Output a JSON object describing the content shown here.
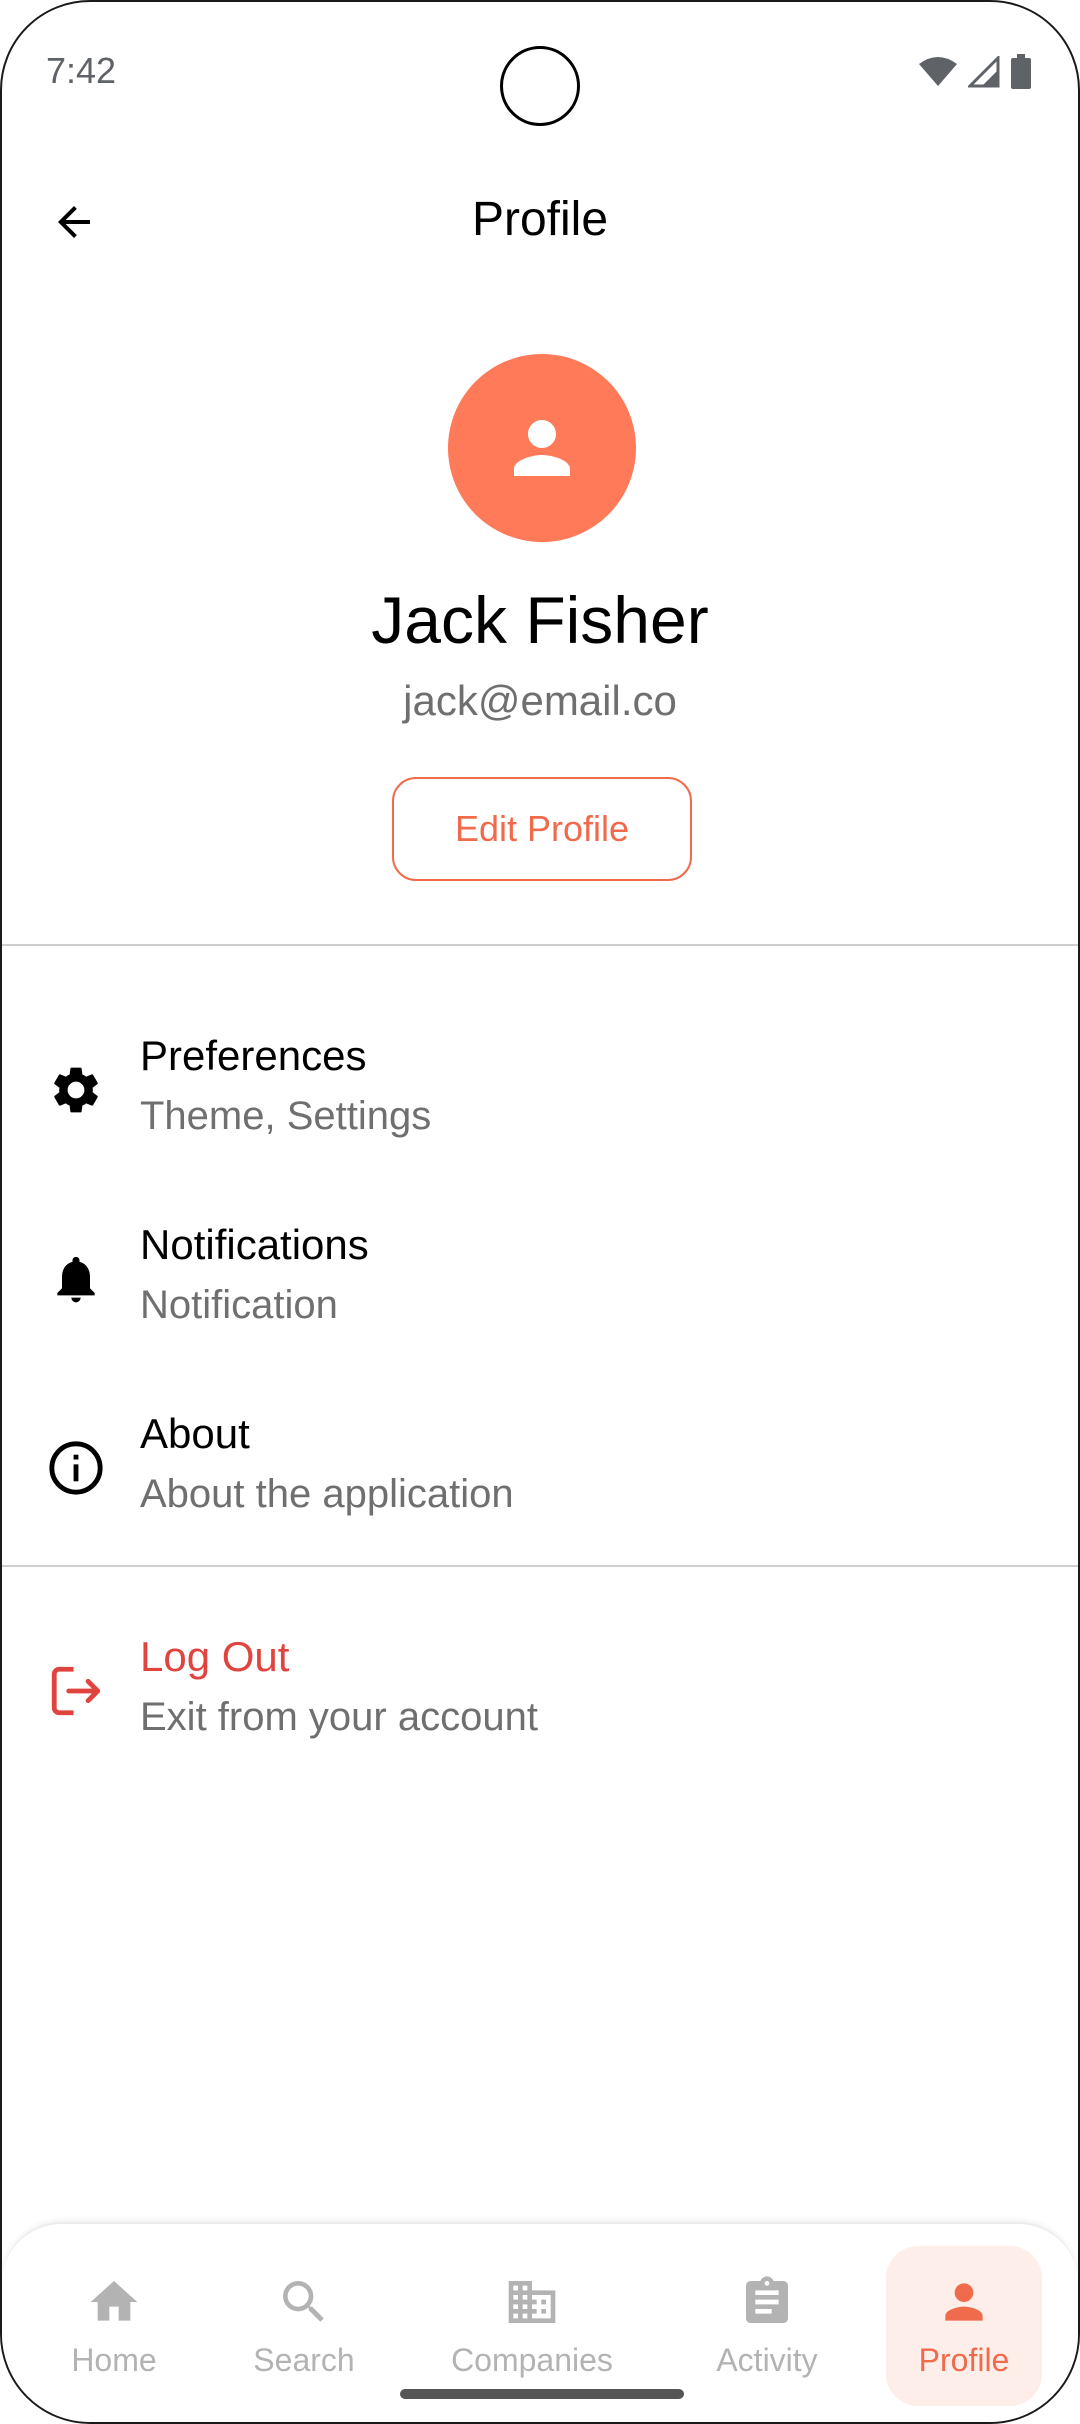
{
  "status_bar": {
    "time": "7:42"
  },
  "app_bar": {
    "title": "Profile"
  },
  "profile": {
    "name": "Jack Fisher",
    "email": "jack@email.co",
    "edit_label": "Edit Profile"
  },
  "menu": [
    {
      "title": "Preferences",
      "subtitle": "Theme, Settings",
      "icon": "gear-icon"
    },
    {
      "title": "Notifications",
      "subtitle": "Notification",
      "icon": "bell-icon"
    },
    {
      "title": "About",
      "subtitle": "About the application",
      "icon": "info-icon"
    }
  ],
  "logout": {
    "title": "Log Out",
    "subtitle": "Exit from your account",
    "icon": "logout-icon"
  },
  "bottom_nav": [
    {
      "label": "Home",
      "icon": "home-icon"
    },
    {
      "label": "Search",
      "icon": "search-icon"
    },
    {
      "label": "Companies",
      "icon": "building-icon"
    },
    {
      "label": "Activity",
      "icon": "clipboard-icon"
    },
    {
      "label": "Profile",
      "icon": "person-icon",
      "active": true
    }
  ],
  "colors": {
    "accent": "#f06a4c",
    "avatar_bg": "#ff7a59",
    "logout": "#e0443e",
    "inactive": "#b3b3b3"
  }
}
